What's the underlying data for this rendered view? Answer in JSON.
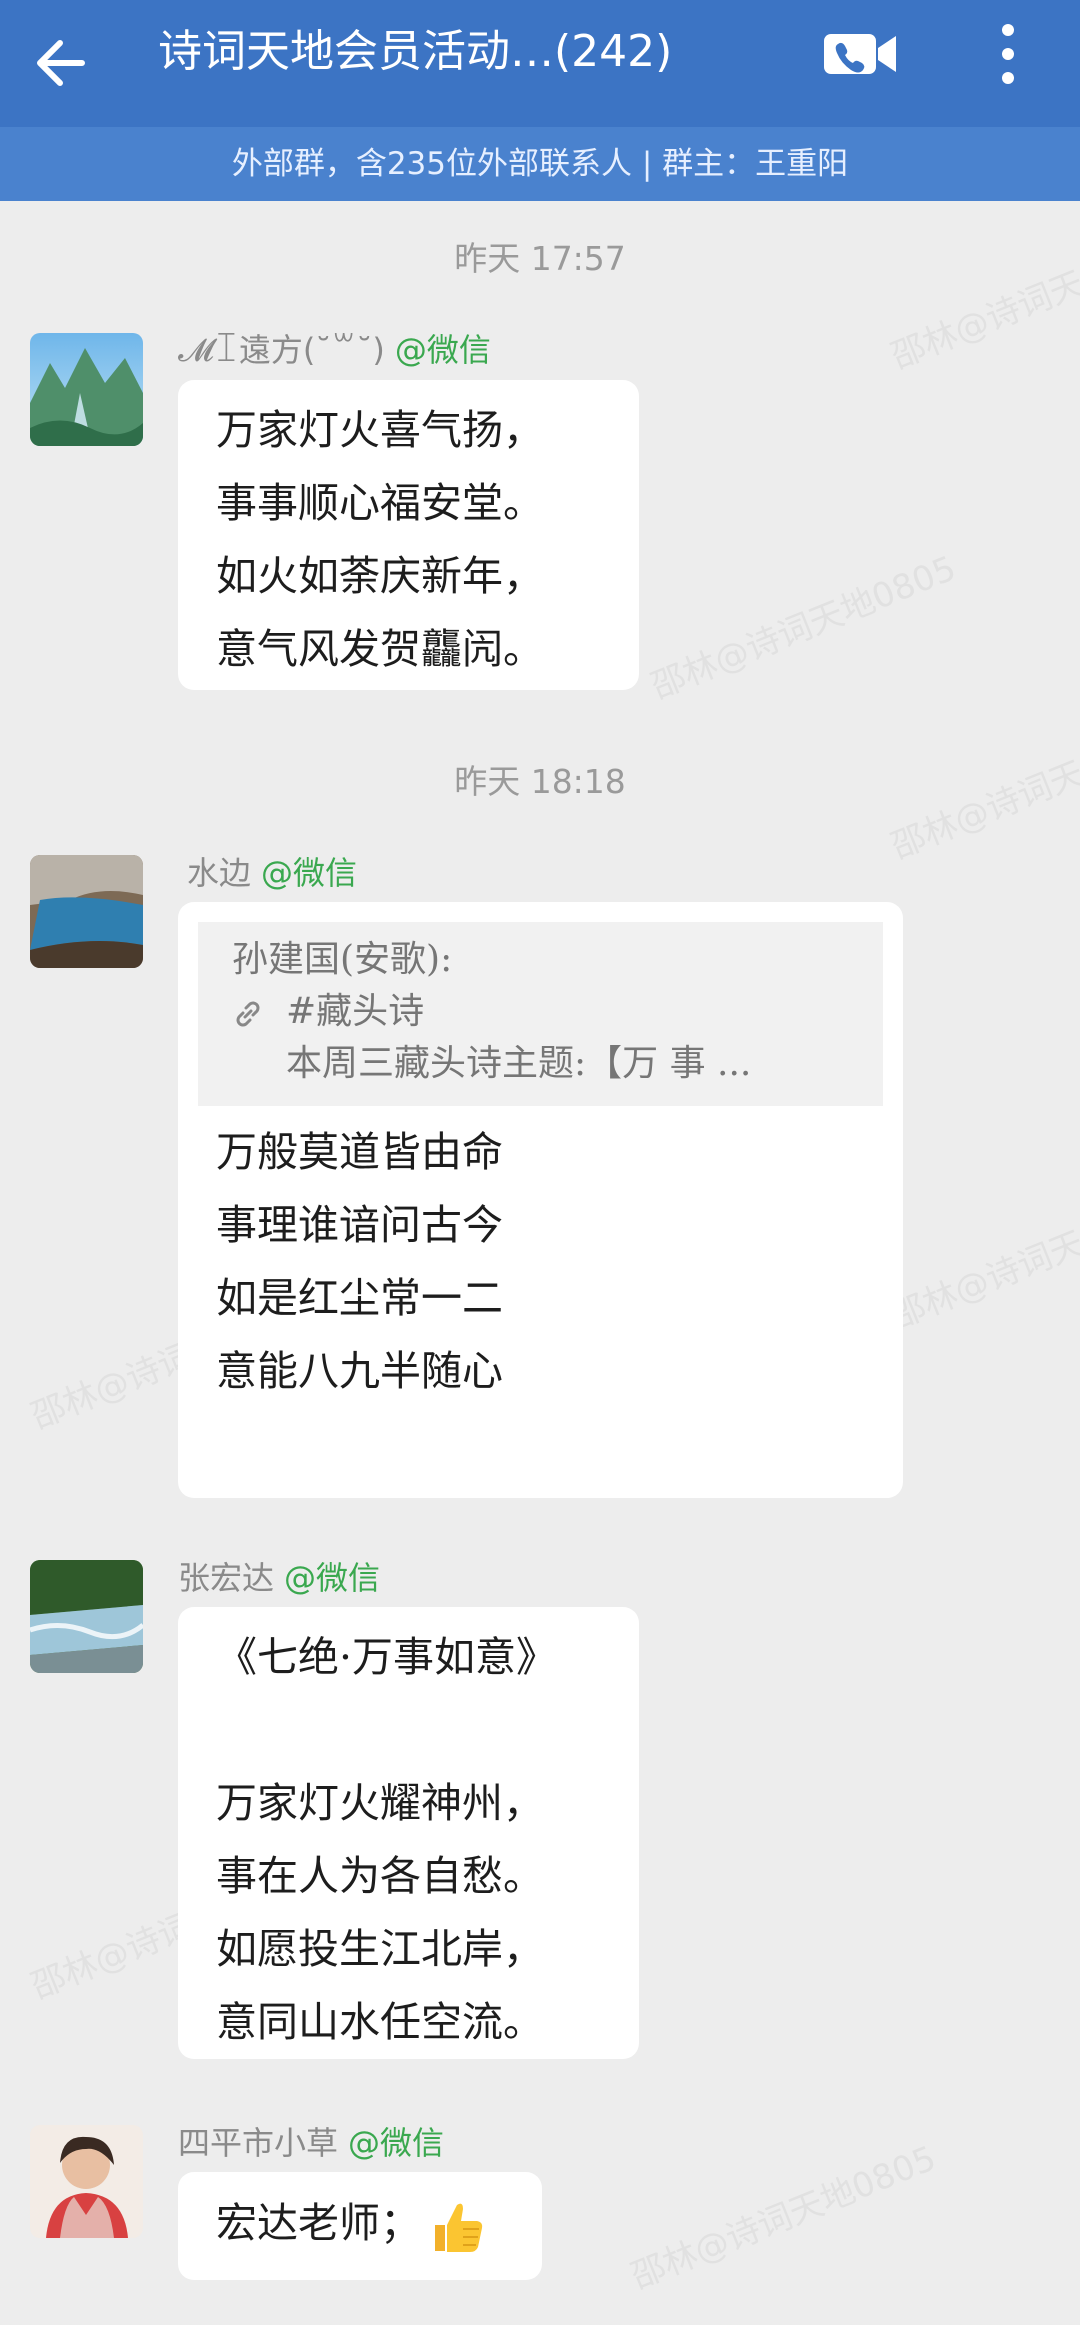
{
  "header": {
    "title": "诗词天地会员活动…(242)",
    "subtitle": "外部群，含235位外部联系人 | 群主：王重阳",
    "icons": [
      "back-arrow-icon",
      "video-call-icon",
      "more-vertical-icon"
    ]
  },
  "timestamps": [
    "昨天  17:57",
    "昨天  18:18"
  ],
  "watermark": "邵林@诗词天地0805",
  "messages": [
    {
      "sender": "𝓜ꀤ遠方(˘꒳˘)",
      "via": "@微信",
      "lines": [
        "万家灯火喜气扬，",
        "事事顺心福安堂。",
        "如火如荼庆新年，",
        "意气风发贺龘闶。"
      ]
    },
    {
      "sender": "水边",
      "via": "@微信",
      "quote": {
        "author": "孙建国(安歌):",
        "tag": "#藏头诗",
        "preview": "本周三藏头诗主题:【万  事  ..."
      },
      "lines": [
        "万般莫道皆由命",
        "事理谁谙问古今",
        "如是红尘常一二",
        "意能八九半随心"
      ]
    },
    {
      "sender": "张宏达",
      "via": "@微信",
      "lines": [
        "《七绝·万事如意》",
        "",
        "万家灯火耀神州，",
        "事在人为各自愁。",
        "如愿投生江北岸，",
        "意同山水任空流。"
      ]
    },
    {
      "sender": "四平市小草",
      "via": "@微信",
      "lines": [
        "宏达老师；"
      ],
      "emoji": "thumbs-up-icon"
    }
  ],
  "colors": {
    "header": "#3c74c4",
    "subheader": "#4a82ce",
    "via": "#3aa84f",
    "background": "#ededed"
  }
}
